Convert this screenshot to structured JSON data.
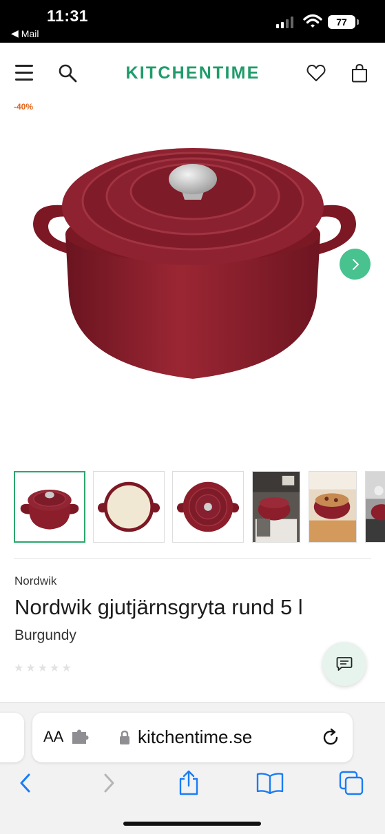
{
  "status_bar": {
    "time": "11:31",
    "back_app": "Mail",
    "battery": "77"
  },
  "header": {
    "logo": "KITCHENTIME",
    "logo_color": "#1f9c6a"
  },
  "product": {
    "discount_badge": "-40%",
    "brand": "Nordwik",
    "title": "Nordwik gjutjärnsgryta rund 5 l",
    "variant": "Burgundy",
    "rating_stars": 0,
    "rating_max": 5,
    "pot_color": "#8b1e2a"
  },
  "gallery": {
    "thumbnails": [
      {
        "name": "pot-front",
        "active": true
      },
      {
        "name": "pot-inside",
        "active": false
      },
      {
        "name": "pot-top",
        "active": false
      },
      {
        "name": "kitchen-photo-1",
        "active": false
      },
      {
        "name": "kitchen-photo-2",
        "active": false
      },
      {
        "name": "kitchen-photo-3",
        "active": false
      }
    ]
  },
  "browser": {
    "text_size_label": "AA",
    "url": "kitchentime.se"
  },
  "icons": {
    "menu": "menu-icon",
    "search": "search-icon",
    "wishlist": "heart-icon",
    "cart": "bag-icon",
    "next": "chevron-right-icon",
    "chat": "chat-icon",
    "back": "chevron-left-icon",
    "forward": "chevron-right-icon",
    "share": "share-icon",
    "bookmarks": "book-icon",
    "tabs": "tabs-icon"
  },
  "colors": {
    "accent_green": "#48c28f",
    "discount_orange": "#e1661f",
    "ios_blue": "#1a7cf5"
  }
}
